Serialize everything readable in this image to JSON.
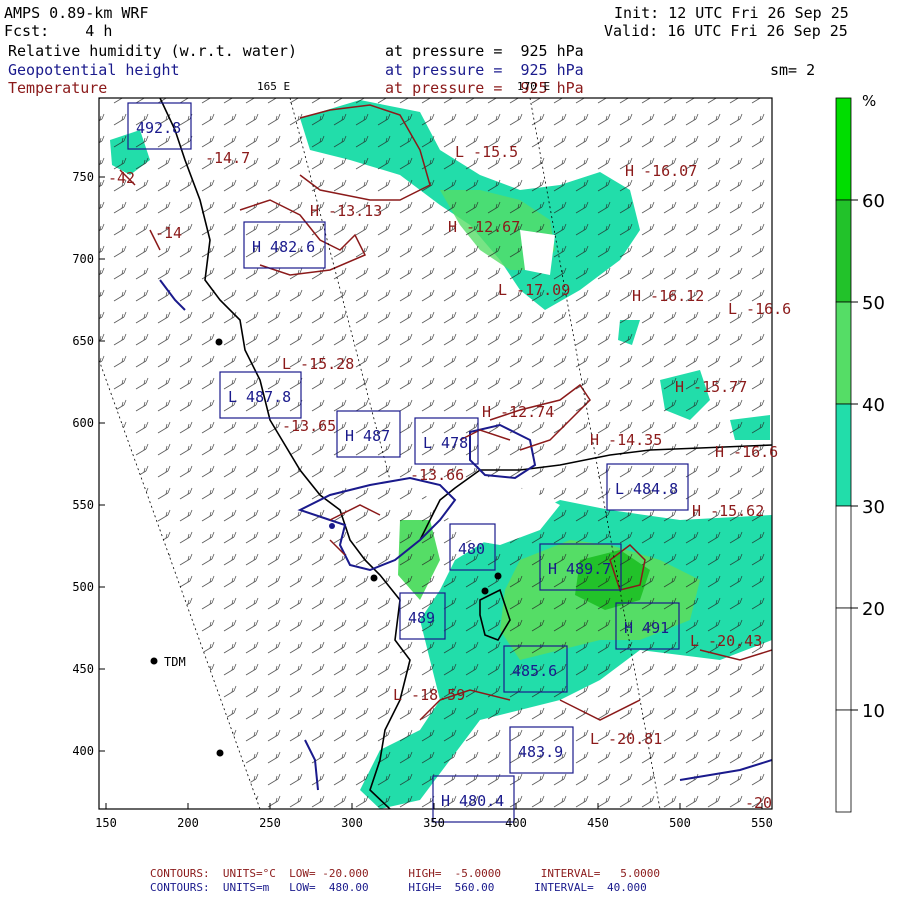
{
  "header": {
    "model": "AMPS 0.89-km WRF",
    "forecast": "Fcst:    4 h",
    "init": "Init: 12 UTC Fri 26 Sep 25",
    "valid": "Valid: 16 UTC Fri 26 Sep 25",
    "sm": "sm= 2"
  },
  "fields": [
    {
      "name": "Relative humidity (w.r.t. water)",
      "pressure": "at pressure =  925 hPa",
      "color": "#000000"
    },
    {
      "name": "Geopotential height",
      "pressure": "at pressure =  925 hPa",
      "color": "#1a1a8c"
    },
    {
      "name": "Temperature",
      "pressure": "at pressure =  925 hPa",
      "color": "#8b1a1a"
    }
  ],
  "map": {
    "lon_labels": {
      "left": "165 E",
      "right": "170 E"
    },
    "x_ticks": [
      "150",
      "200",
      "250",
      "300",
      "350",
      "400",
      "450",
      "500",
      "550"
    ],
    "y_ticks": [
      "750",
      "700",
      "650",
      "600",
      "550",
      "500",
      "450",
      "400"
    ],
    "station": "TDM"
  },
  "colorbar": {
    "unit": "%",
    "labels": [
      "60",
      "50",
      "40",
      "30",
      "20",
      "10"
    ],
    "bands": [
      {
        "range": "60-70",
        "color": "#00dd00"
      },
      {
        "range": "50-60",
        "color": "#22c22a"
      },
      {
        "range": "40-50",
        "color": "#55dd66"
      },
      {
        "range": "30-40",
        "color": "#22ddaa"
      },
      {
        "range": "20-30",
        "color": "#ffffff"
      },
      {
        "range": "10-20",
        "color": "#ffffff"
      },
      {
        "range": "0-10",
        "color": "#ffffff"
      }
    ]
  },
  "temperature_labels": [
    {
      "text": "-14.7",
      "marker": ""
    },
    {
      "text": "-15.5",
      "marker": "L"
    },
    {
      "text": "-16.07",
      "marker": "H"
    },
    {
      "text": "-13.13",
      "marker": "H"
    },
    {
      "text": "-12.67",
      "marker": "H"
    },
    {
      "text": "-17.09",
      "marker": "L"
    },
    {
      "text": "-16.12",
      "marker": "H"
    },
    {
      "text": "-16.6",
      "marker": "L"
    },
    {
      "text": "-15.28",
      "marker": "L"
    },
    {
      "text": "-15.77",
      "marker": "H"
    },
    {
      "text": "-13.65",
      "marker": ""
    },
    {
      "text": "-12.74",
      "marker": "H"
    },
    {
      "text": "-14.35",
      "marker": "H"
    },
    {
      "text": "-16.6",
      "marker": "H"
    },
    {
      "text": "-13.66",
      "marker": ""
    },
    {
      "text": "-15.62",
      "marker": "H"
    },
    {
      "text": "-20.43",
      "marker": "L"
    },
    {
      "text": "-18.59",
      "marker": "L"
    },
    {
      "text": "-20.81",
      "marker": "L"
    },
    {
      "text": "-20",
      "marker": ""
    },
    {
      "text": "-42",
      "marker": ""
    },
    {
      "text": "-14",
      "marker": ""
    }
  ],
  "height_labels": [
    {
      "text": "492.8",
      "marker": ""
    },
    {
      "text": "482.6",
      "marker": "H"
    },
    {
      "text": "487.8",
      "marker": "L"
    },
    {
      "text": "487",
      "marker": "H"
    },
    {
      "text": "478",
      "marker": "L"
    },
    {
      "text": "484.8",
      "marker": "L"
    },
    {
      "text": "480",
      "marker": ""
    },
    {
      "text": "489.7",
      "marker": "H"
    },
    {
      "text": "491",
      "marker": "H"
    },
    {
      "text": "485.6",
      "marker": ""
    },
    {
      "text": "483.9",
      "marker": ""
    },
    {
      "text": "480.4",
      "marker": "H"
    },
    {
      "text": "489",
      "marker": ""
    }
  ],
  "footer": {
    "line1": {
      "label": "CONTOURS:",
      "units": "UNITS=°C",
      "low": "LOW= -20.000",
      "high": "HIGH=  -5.0000",
      "interval": "INTERVAL=   5.0000"
    },
    "line2": {
      "label": "CONTOURS:",
      "units": "UNITS=m",
      "low": "LOW=  480.00",
      "high": "HIGH=  560.00",
      "interval": "INTERVAL=  40.000"
    }
  }
}
